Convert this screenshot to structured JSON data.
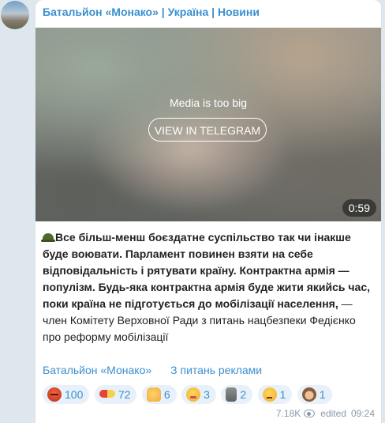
{
  "channel": {
    "name": "Батальйон «Монако» | Україна | Новини"
  },
  "media": {
    "notice": "Media is too big",
    "button_label": "VIEW IN TELEGRAM",
    "duration": "0:59"
  },
  "post": {
    "bold_text": "Все більш-менш боєздатне суспільство так чи інакше буде воювати. Парламент повинен взяти на себе відповідальність і рятувати країну. Контрактна армія — популізм. Будь-яка контрактна армія буде жити якийсь час, поки країна не підготується до мобілізації населення,",
    "normal_text": " — член Комітету Верховної Ради з питань нацбезпеки Федієнко про реформу мобілізації"
  },
  "links": {
    "channel_link": "Батальйон «Монако»",
    "ads_link": "З питань реклами"
  },
  "reactions": [
    {
      "icon": "angry-face-icon",
      "count": "100"
    },
    {
      "icon": "pill-icon",
      "count": "72"
    },
    {
      "icon": "thumbs-up-icon",
      "count": "6"
    },
    {
      "icon": "woozy-face-icon",
      "count": "3"
    },
    {
      "icon": "moai-icon",
      "count": "2"
    },
    {
      "icon": "thinking-face-icon",
      "count": "1"
    },
    {
      "icon": "see-no-evil-monkey-icon",
      "count": "1"
    }
  ],
  "meta": {
    "views": "7.18K",
    "edited_label": "edited",
    "time": "09:24"
  },
  "colors": {
    "background": "#dfe7ee",
    "accent": "#3a8fd0",
    "reaction_bg": "#e8f1f9",
    "meta_text": "#8a9aa8"
  }
}
